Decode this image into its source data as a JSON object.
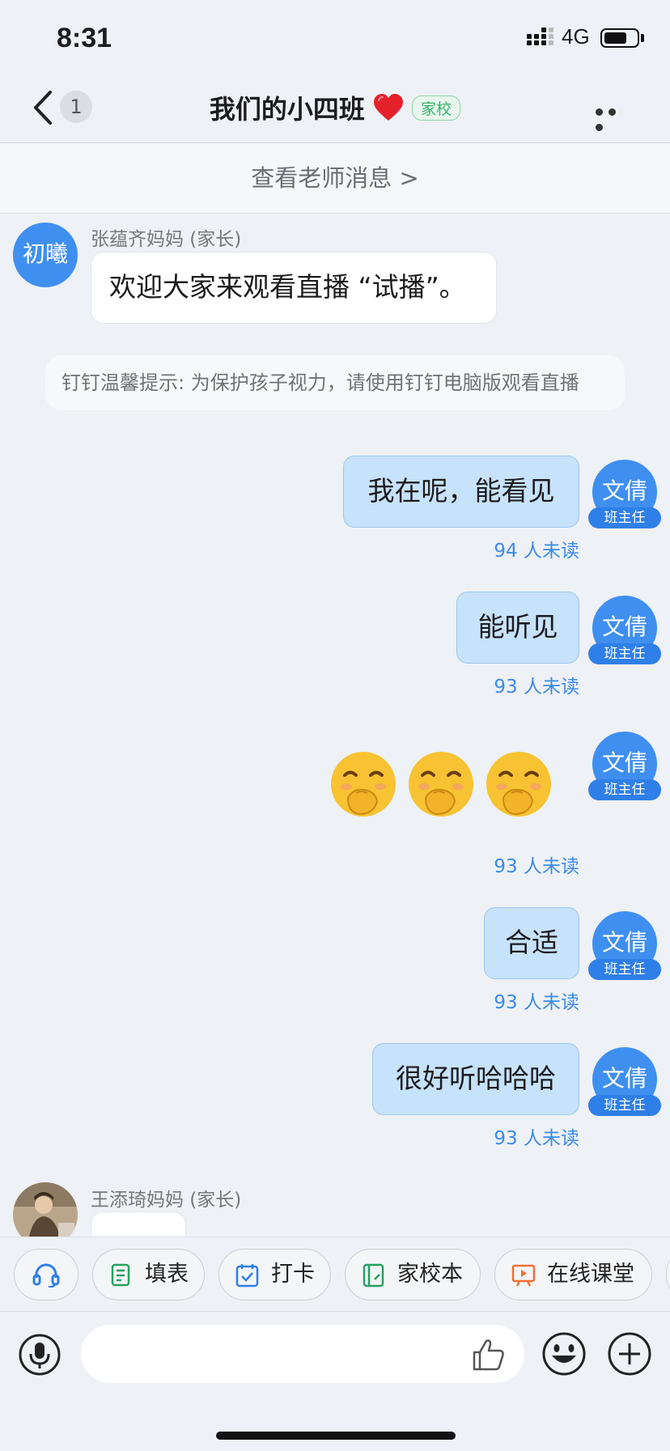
{
  "status_bar": {
    "time": "8:31",
    "network": "4G"
  },
  "nav": {
    "unread_count": "1",
    "group_name": "我们的小四班",
    "group_tag": "家校"
  },
  "teacher_bar": {
    "label": "查看老师消息 >"
  },
  "messages": [
    {
      "type": "incoming",
      "avatar_text": "初曦",
      "sender": "张蕴齐妈妈 (家长)",
      "text": "欢迎大家来观看直播 “试播”。"
    },
    {
      "type": "system",
      "text": "钉钉温馨提示: 为保护孩子视力，请使用钉钉电脑版观看直播"
    },
    {
      "type": "outgoing",
      "avatar_text": "文倩",
      "role": "班主任",
      "text": "我在呢，能看见",
      "read_status": "94 人未读"
    },
    {
      "type": "outgoing",
      "avatar_text": "文倩",
      "role": "班主任",
      "text": "能听见",
      "read_status": "93 人未读"
    },
    {
      "type": "outgoing-emoji",
      "avatar_text": "文倩",
      "role": "班主任",
      "emoji": "face-with-hand-over-mouth",
      "count": 3,
      "read_status": "93 人未读"
    },
    {
      "type": "outgoing",
      "avatar_text": "文倩",
      "role": "班主任",
      "text": "合适",
      "read_status": "93 人未读"
    },
    {
      "type": "outgoing",
      "avatar_text": "文倩",
      "role": "班主任",
      "text": "很好听哈哈哈",
      "read_status": "93 人未读"
    },
    {
      "type": "incoming",
      "avatar": "photo",
      "sender": "王添琦妈妈 (家长)",
      "text": ""
    }
  ],
  "toolbar": {
    "items": [
      {
        "icon": "headset-icon",
        "label": ""
      },
      {
        "icon": "form-icon",
        "label": "填表"
      },
      {
        "icon": "checkin-icon",
        "label": "打卡"
      },
      {
        "icon": "notebook-icon",
        "label": "家校本"
      },
      {
        "icon": "presentation-icon",
        "label": "在线课堂"
      }
    ]
  },
  "input": {
    "placeholder": ""
  },
  "colors": {
    "accent": "#3f8ff0",
    "bubble_out": "#c7e2fb",
    "read_status": "#3c8be8",
    "tag_green": "#3ab26a"
  }
}
